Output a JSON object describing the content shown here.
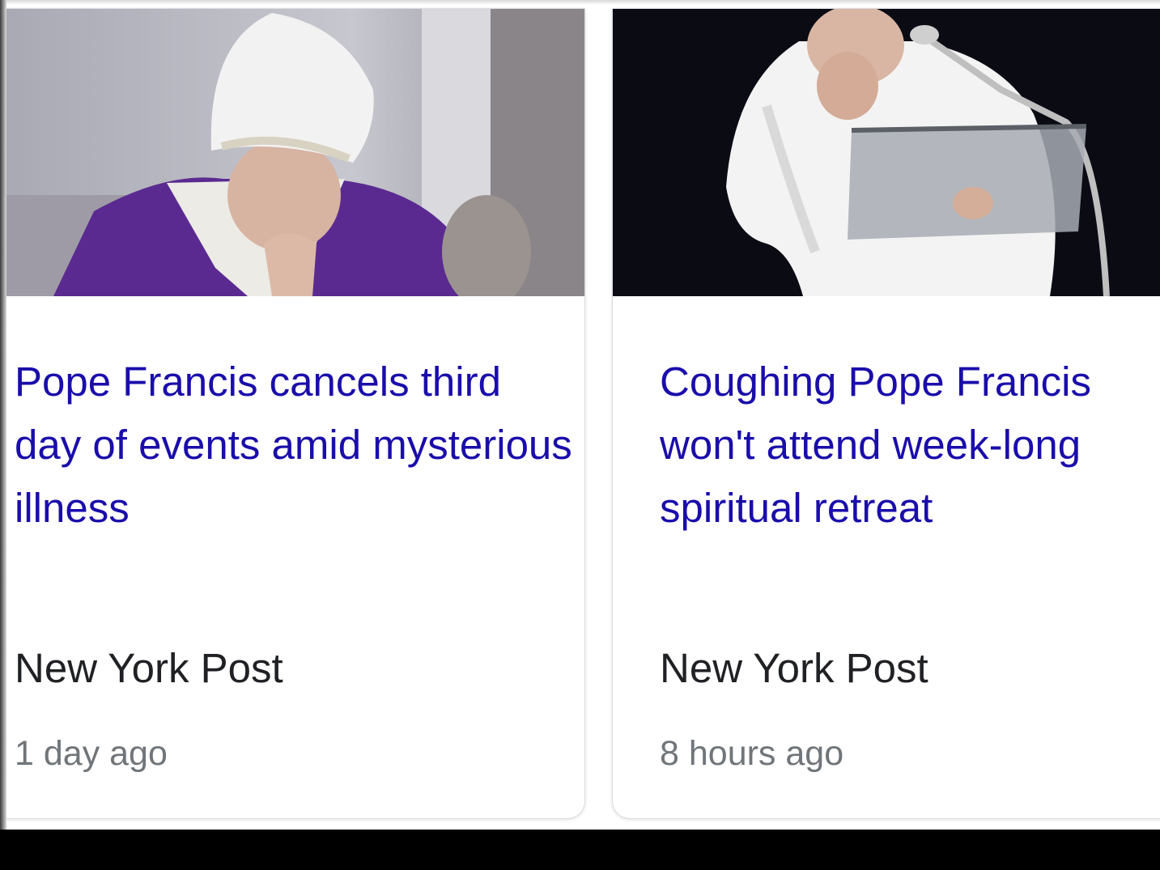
{
  "news_cards": [
    {
      "headline": "Pope Francis cancels third day of events amid mysterious illness",
      "source": "New York Post",
      "age": "1 day ago",
      "image_colors": {
        "vestment": "#5b2a91",
        "background": "#b9b9c2",
        "mitre": "#f1f1f1"
      }
    },
    {
      "headline": "Coughing Pope Francis won't attend week-long spiritual retreat",
      "source": "New York Post",
      "age": "8 hours ago",
      "image_colors": {
        "background": "#0b0b14",
        "cassock": "#f3f3f3",
        "lectern": "#a7acb3"
      }
    }
  ],
  "colors": {
    "headline_link": "#1a0dab",
    "source_text": "#202124",
    "meta_text": "#70757a"
  }
}
